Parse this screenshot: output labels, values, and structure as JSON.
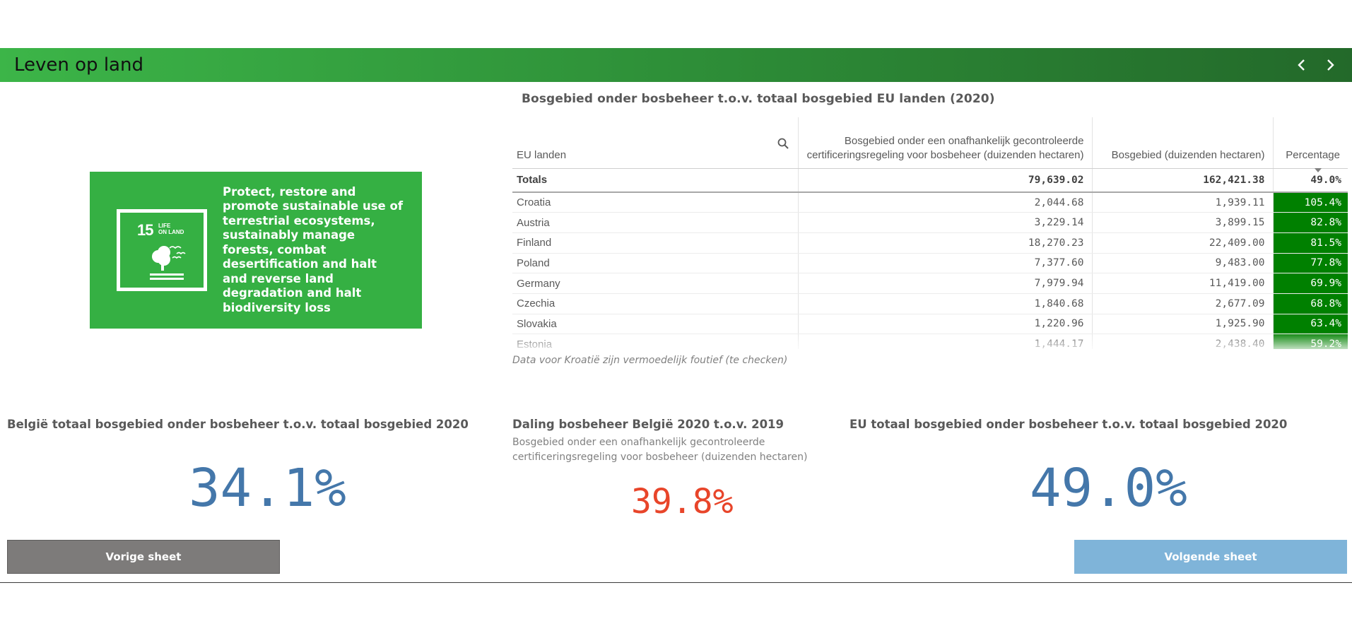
{
  "header": {
    "title": "Leven op land",
    "prev_icon": "chevron-left-icon",
    "next_icon": "chevron-right-icon"
  },
  "sdg": {
    "number": "15",
    "label_line1": "LIFE",
    "label_line2": "ON LAND",
    "text": "Protect, restore and promote sustainable use of terrestrial ecosystems, sustainably manage forests, combat desertification and halt and reverse land degradation and halt biodiversity loss",
    "color": "#35b043"
  },
  "table": {
    "title": "Bosgebied onder bosbeheer t.o.v. totaal bosgebied EU landen (2020)",
    "columns": {
      "country": "EU landen",
      "certified": "Bosgebied onder een onafhankelijk gecontroleerde certificeringsregeling voor bosbeheer (duizenden hectaren)",
      "area": "Bosgebied (duizenden hectaren)",
      "percentage": "Percentage"
    },
    "totals": {
      "label": "Totals",
      "certified": "79,639.02",
      "area": "162,421.38",
      "percentage": "49.0%"
    },
    "rows": [
      {
        "country": "Croatia",
        "certified": "2,044.68",
        "area": "1,939.11",
        "percentage": "105.4%"
      },
      {
        "country": "Austria",
        "certified": "3,229.14",
        "area": "3,899.15",
        "percentage": "82.8%"
      },
      {
        "country": "Finland",
        "certified": "18,270.23",
        "area": "22,409.00",
        "percentage": "81.5%"
      },
      {
        "country": "Poland",
        "certified": "7,377.60",
        "area": "9,483.00",
        "percentage": "77.8%"
      },
      {
        "country": "Germany",
        "certified": "7,979.94",
        "area": "11,419.00",
        "percentage": "69.9%"
      },
      {
        "country": "Czechia",
        "certified": "1,840.68",
        "area": "2,677.09",
        "percentage": "68.8%"
      },
      {
        "country": "Slovakia",
        "certified": "1,220.96",
        "area": "1,925.90",
        "percentage": "63.4%"
      },
      {
        "country": "Estonia",
        "certified": "1,444.17",
        "area": "2,438.40",
        "percentage": "59.2%"
      }
    ],
    "note": "Data voor Kroatië zijn vermoedelijk foutief (te checken)",
    "highlight_color": "#008000"
  },
  "kpis": {
    "belgium": {
      "title": "België totaal bosgebied onder bosbeheer t.o.v. totaal bosgebied 2020",
      "value": "34.1%",
      "color": "#4477aa"
    },
    "decline": {
      "title": "Daling bosbeheer België 2020 t.o.v. 2019",
      "subtitle": "Bosgebied onder een onafhankelijk gecontroleerde certificeringsregeling voor bosbeheer (duizenden hectaren)",
      "value": "39.8%",
      "color": "#e8452a"
    },
    "eu": {
      "title": "EU totaal bosgebied onder bosbeheer t.o.v. totaal bosgebied 2020",
      "value": "49.0%",
      "color": "#4477aa"
    }
  },
  "buttons": {
    "prev_label": "Vorige sheet",
    "next_label": "Volgende sheet"
  }
}
